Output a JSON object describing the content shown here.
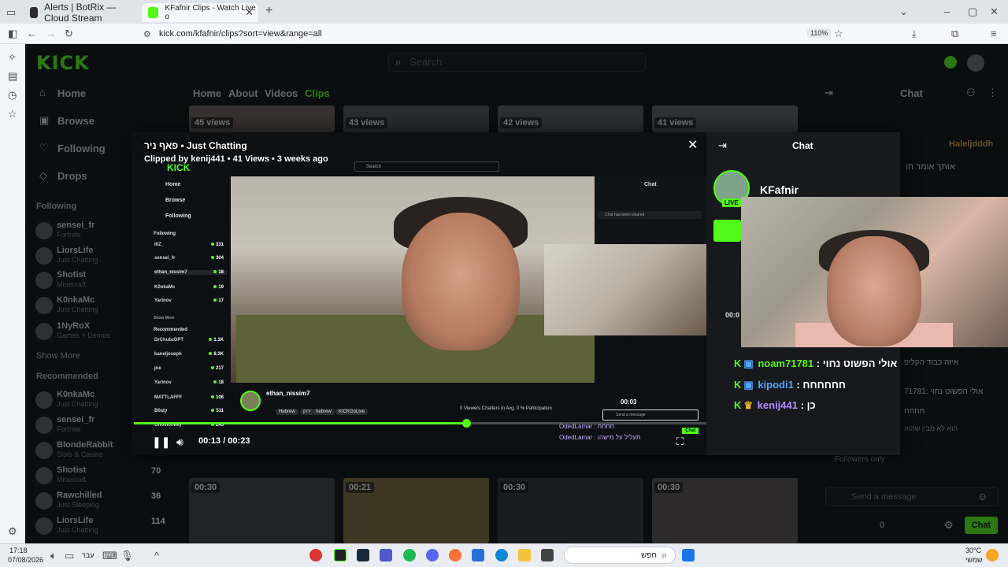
{
  "browser": {
    "tabs": [
      {
        "title": "Alerts | BotRix — Cloud Stream",
        "active": false
      },
      {
        "title": "KFafnir Clips - Watch Live o",
        "active": true
      }
    ],
    "new_tab": "+",
    "url": "kick.com/kfafnir/clips?sort=view&range=all",
    "zoom": "110%"
  },
  "kick": {
    "logo": "KICK",
    "search_placeholder": "Search",
    "nav": [
      "Home",
      "Browse",
      "Following",
      "Drops"
    ],
    "following_title": "Following",
    "following": [
      {
        "name": "sensei_fr",
        "cat": "Fortnite"
      },
      {
        "name": "LiorsLife",
        "cat": "Just Chatting"
      },
      {
        "name": "Shotist",
        "cat": "Minecraft"
      },
      {
        "name": "K0nkaMc",
        "cat": "Just Chatting"
      },
      {
        "name": "1NyRoX",
        "cat": "Games + Demos"
      }
    ],
    "show_more": "Show More",
    "recommended_title": "Recommended",
    "recommended": [
      {
        "name": "K0nkaMc",
        "cat": "Just Chatting"
      },
      {
        "name": "sensei_fr",
        "cat": "Fortnite"
      },
      {
        "name": "BlondeRabbit",
        "cat": "Slots & Casino"
      },
      {
        "name": "Shotist",
        "cat": "Minecraft"
      },
      {
        "name": "Rawchilled",
        "cat": "Just Sleeping"
      },
      {
        "name": "LiorsLife",
        "cat": "Just Chatting"
      }
    ],
    "channel_tabs": [
      "Home",
      "About",
      "Videos",
      "Clips"
    ],
    "active_channel_tab": "Clips",
    "top_views": [
      "45 views",
      "43 views",
      "42 views",
      "41 views"
    ],
    "row2_durations": [
      "00:30",
      "00:21",
      "00:30",
      "00:30"
    ],
    "row2_counts": [
      "70",
      "36",
      "114"
    ],
    "right_chat_title": "Chat",
    "bg_chat_user": "Haleljdddh",
    "bg_chat_lines": [
      "אותך אומר חו",
      "איזה כבוד הקליפ",
      "אולי הפשוט נחוי :71781",
      "חחחח",
      "הוא לא מבין שהוא"
    ],
    "followers_only": "Followers only",
    "send_placeholder": "Send a message",
    "points": "0",
    "chat_button": "Chat"
  },
  "clip_modal": {
    "title": "פאף ניר • Just Chatting",
    "subtitle": "Clipped by kenij441 • 41 Views • 3 weeks ago",
    "time_current": "00:13",
    "time_total": "00:23",
    "time_display": "00:13 / 00:23",
    "progress": 0.58,
    "inner": {
      "logo": "KICK",
      "search": "Search",
      "nav": [
        "Home",
        "Browse",
        "Following"
      ],
      "following_label": "Following",
      "following": [
        {
          "name": "I0Z_",
          "count": "331"
        },
        {
          "name": "sensei_fr",
          "count": "304"
        },
        {
          "name": "ethan_nissim7",
          "count": "18"
        },
        {
          "name": "K0nkaMc",
          "count": "19"
        },
        {
          "name": "Yarinov",
          "count": "17"
        }
      ],
      "show_more": "Show More",
      "recommended_label": "Recommended",
      "recommended": [
        {
          "name": "DrChubzDPT",
          "count": "1.1K"
        },
        {
          "name": "kaneljoseph",
          "count": "8.2K"
        },
        {
          "name": "joe",
          "count": "217"
        },
        {
          "name": "Yarinov",
          "count": "18"
        },
        {
          "name": "MATTLAFFF",
          "count": "106"
        },
        {
          "name": "B0aty",
          "count": "511"
        },
        {
          "name": "Gnomonkey",
          "count": "245"
        }
      ],
      "streamer": "ethan_nissim7",
      "tags": [
        "Hebrew",
        "ירוק",
        "hebrew",
        "KICKGoLive"
      ],
      "stats": "0 Viewers   Chatters in Avg.   0 % Participation",
      "chat_title": "Chat",
      "chat_cleared": "Chat has been cleared",
      "send_message": "Send a message",
      "timer": "00:03",
      "chat_users": [
        "OdedLamar : חחחח",
        "OdedLamar : תעליל על מישהו"
      ],
      "chat_btn": "Chat"
    },
    "chat_panel": {
      "title": "Chat",
      "streamer": "KFafnir",
      "live_badge": "LIVE",
      "timer": "00:0",
      "messages": [
        {
          "user": "noam71781",
          "text": "אולי הפשוט נחוי"
        },
        {
          "user": "kipodi1",
          "text": "חחחחחח"
        },
        {
          "user": "kenij441",
          "text": "כן"
        }
      ]
    }
  },
  "taskbar": {
    "time": "17:18",
    "date": "07/08/2026",
    "lang": "עבר",
    "search": "חפש",
    "weather_temp": "30°C",
    "weather_text": "שמשי"
  },
  "colors": {
    "kick_green": "#53fc18",
    "page_bg": "#0b0e0f",
    "modal_bg": "#14161a"
  }
}
